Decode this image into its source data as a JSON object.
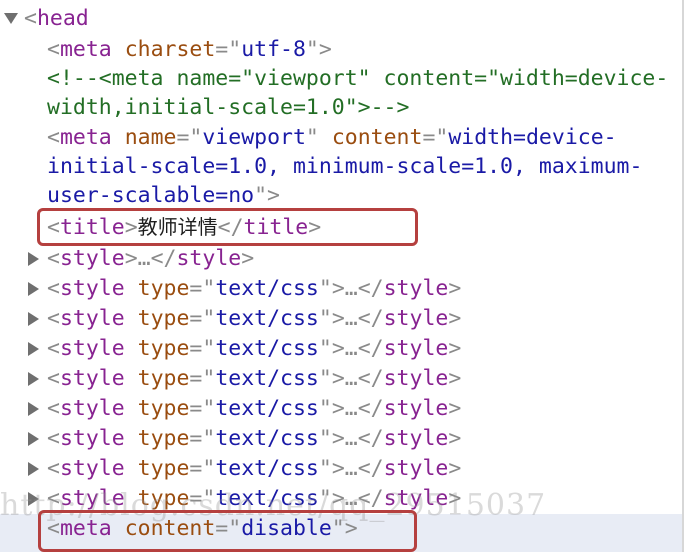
{
  "lines": {
    "head": "head",
    "meta_charset": {
      "attr": "charset",
      "val": "utf-8"
    },
    "comment_1": "<!--<meta name=\"viewport\" content=\"width=device-",
    "comment_2": "width,initial-scale=1.0\">-->",
    "meta_viewport": {
      "attr1": "name",
      "val1": "viewport",
      "attr2": "content",
      "val_1": "width=device-",
      "val_2": "initial-scale=1.0, minimum-scale=1.0, maximum-",
      "val_3": "user-scalable=no"
    },
    "title_tag": "title",
    "title_text": "教师详情",
    "style_plain": "style",
    "ellipsis": "…",
    "style_typed": {
      "attr": "type",
      "val": "text/css"
    },
    "meta_content": {
      "attr": "content",
      "val": "disable"
    }
  },
  "watermark": "http://blog.csdn.net/qq_29515037"
}
